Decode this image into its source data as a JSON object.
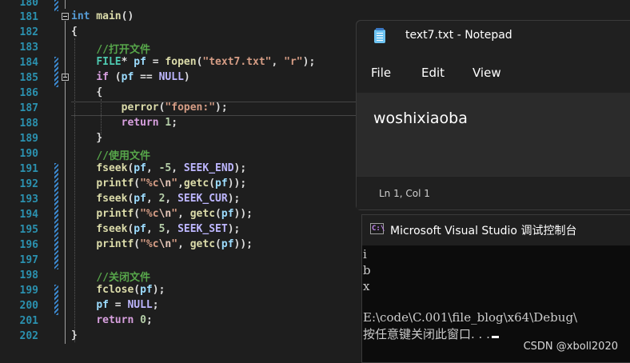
{
  "editor": {
    "line_numbers": [
      "180",
      "181",
      "182",
      "183",
      "184",
      "185",
      "186",
      "187",
      "188",
      "189",
      "190",
      "191",
      "192",
      "193",
      "194",
      "195",
      "196",
      "197",
      "198",
      "199",
      "200",
      "201",
      "202"
    ],
    "code": {
      "l181": {
        "kw": "int",
        "name": " main",
        "rest": "()"
      },
      "l182": {
        "text": "{"
      },
      "l183": {
        "comment": "//打开文件"
      },
      "l184": {
        "type": "FILE",
        "star": "* ",
        "var": "pf",
        "eq": " = ",
        "fn": "fopen",
        "open": "(",
        "s1": "\"text7.txt\"",
        "comma": ", ",
        "s2": "\"r\"",
        "close": ");"
      },
      "l185": {
        "ctl": "if",
        "p1": " (",
        "var": "pf",
        "op": " == ",
        "mac": "NULL",
        "p2": ")"
      },
      "l186": {
        "text": "{"
      },
      "l187": {
        "fn": "perror",
        "p1": "(",
        "str": "\"fopen:\"",
        "p2": ");"
      },
      "l188": {
        "ctl": "return",
        "sp": " ",
        "num": "1",
        "semi": ";"
      },
      "l189": {
        "text": "}"
      },
      "l190": {
        "comment": "//使用文件"
      },
      "l191": {
        "fn": "fseek",
        "p1": "(",
        "var": "pf",
        "c1": ", ",
        "num": "-5",
        "c2": ", ",
        "mac": "SEEK_END",
        "p2": ");"
      },
      "l192": {
        "fn": "printf",
        "p1": "(",
        "q1": "\"%c",
        "esc": "\\n",
        "q2": "\"",
        "c": ",",
        "fn2": "getc",
        "p2": "(",
        "var": "pf",
        "p3": "));"
      },
      "l193": {
        "fn": "fseek",
        "p1": "(",
        "var": "pf",
        "c1": ", ",
        "num": "2",
        "c2": ", ",
        "mac": "SEEK_CUR",
        "p2": ");"
      },
      "l194": {
        "fn": "printf",
        "p1": "(",
        "q1": "\"%c",
        "esc": "\\n",
        "q2": "\"",
        "c": ", ",
        "fn2": "getc",
        "p2": "(",
        "var": "pf",
        "p3": "));"
      },
      "l195": {
        "fn": "fseek",
        "p1": "(",
        "var": "pf",
        "c1": ", ",
        "num": "5",
        "c2": ", ",
        "mac": "SEEK_SET",
        "p2": ");"
      },
      "l196": {
        "fn": "printf",
        "p1": "(",
        "q1": "\"%c",
        "esc": "\\n",
        "q2": "\"",
        "c": ", ",
        "fn2": "getc",
        "p2": "(",
        "var": "pf",
        "p3": "));"
      },
      "l198": {
        "comment": "//关闭文件"
      },
      "l199": {
        "fn": "fclose",
        "p1": "(",
        "var": "pf",
        "p2": ");"
      },
      "l200": {
        "var": "pf",
        "eq": " = ",
        "mac": "NULL",
        "semi": ";"
      },
      "l201": {
        "ctl": "return",
        "sp": " ",
        "num": "0",
        "semi": ";"
      },
      "l202": {
        "text": "}"
      }
    }
  },
  "notepad": {
    "title": "text7.txt - Notepad",
    "icon": "notepad-icon",
    "menu": [
      "File",
      "Edit",
      "View"
    ],
    "content": "woshixiaoba",
    "status": "Ln 1, Col 1"
  },
  "console": {
    "title": "Microsoft Visual Studio 调试控制台",
    "icon": "console-icon",
    "icon_glyph": "C:\\",
    "lines": [
      "i",
      "b",
      "x",
      "",
      "E:\\code\\C.001\\file_blog\\x64\\Debug\\",
      "按任意键关闭此窗口. . ."
    ]
  },
  "watermark": "CSDN @xboll2020",
  "colors": {
    "editor_bg": "#1e1e1e",
    "line_number": "#2b91af",
    "keyword": "#569cd6",
    "control": "#d8a0df",
    "function": "#dcdcaa",
    "string": "#d69d85",
    "variable": "#9cdcfe",
    "macro": "#beb7ff",
    "comment": "#57a64a",
    "change_bar": "#3c89d0"
  }
}
